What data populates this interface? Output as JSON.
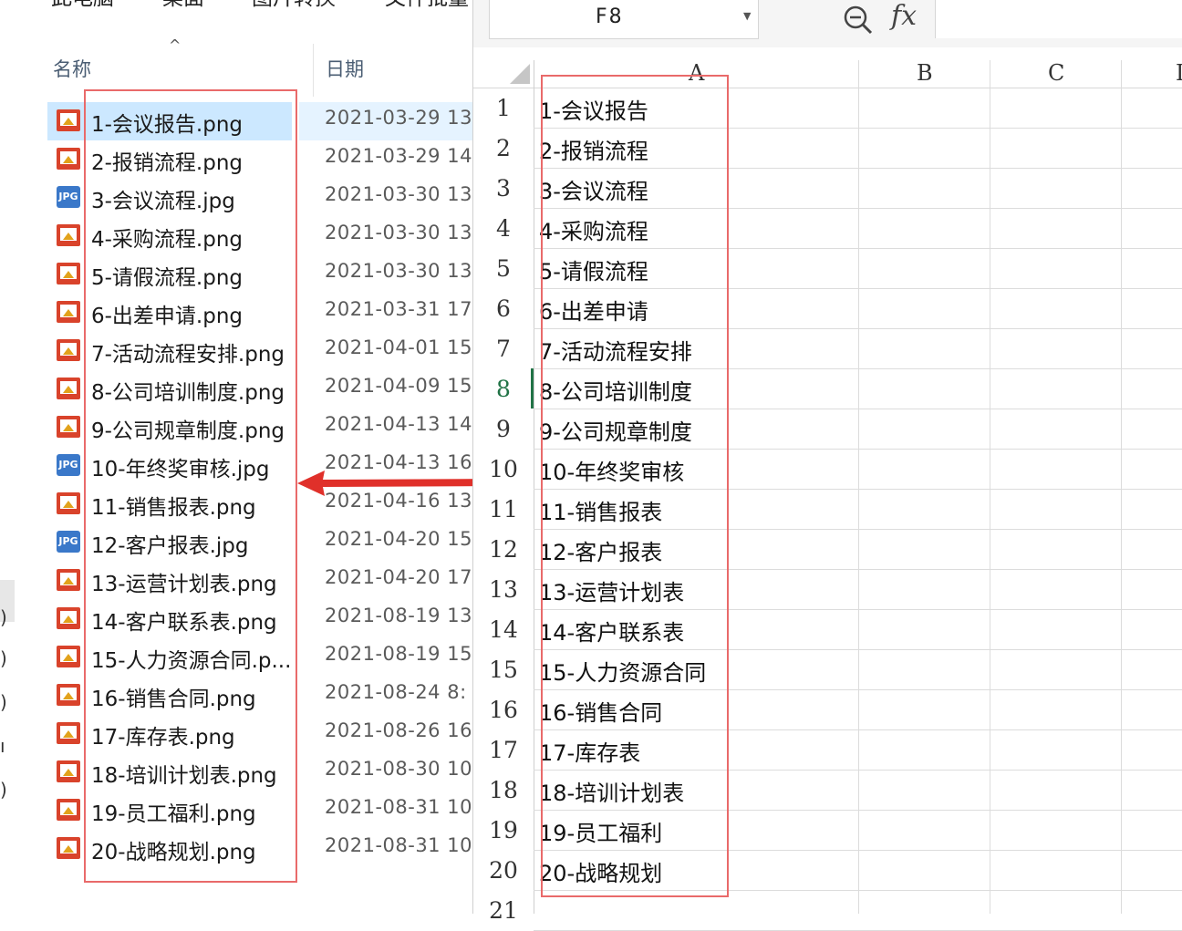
{
  "explorer": {
    "breadcrumb": [
      "此电脑",
      "桌面",
      "图片转换",
      "文件批量"
    ],
    "columns": {
      "name": "名称",
      "date": "日期"
    },
    "nav_fragments": [
      ")",
      ")",
      ")",
      "ı",
      ")"
    ],
    "files": [
      {
        "name": "1-会议报告.png",
        "date": "2021-03-29 13",
        "type": "png"
      },
      {
        "name": "2-报销流程.png",
        "date": "2021-03-29 14",
        "type": "png"
      },
      {
        "name": "3-会议流程.jpg",
        "date": "2021-03-30 13",
        "type": "jpg"
      },
      {
        "name": "4-采购流程.png",
        "date": "2021-03-30 13",
        "type": "png"
      },
      {
        "name": "5-请假流程.png",
        "date": "2021-03-30 13",
        "type": "png"
      },
      {
        "name": "6-出差申请.png",
        "date": "2021-03-31 17",
        "type": "png"
      },
      {
        "name": "7-活动流程安排.png",
        "date": "2021-04-01 15",
        "type": "png"
      },
      {
        "name": "8-公司培训制度.png",
        "date": "2021-04-09 15",
        "type": "png"
      },
      {
        "name": "9-公司规章制度.png",
        "date": "2021-04-13 14",
        "type": "png"
      },
      {
        "name": "10-年终奖审核.jpg",
        "date": "2021-04-13 16",
        "type": "jpg"
      },
      {
        "name": "11-销售报表.png",
        "date": "2021-04-16 13",
        "type": "png"
      },
      {
        "name": "12-客户报表.jpg",
        "date": "2021-04-20 15",
        "type": "jpg"
      },
      {
        "name": "13-运营计划表.png",
        "date": "2021-04-20 17",
        "type": "png"
      },
      {
        "name": "14-客户联系表.png",
        "date": "2021-08-19 13",
        "type": "png"
      },
      {
        "name": "15-人力资源合同.p...",
        "date": "2021-08-19 15",
        "type": "png"
      },
      {
        "name": "16-销售合同.png",
        "date": "2021-08-24 8:",
        "type": "png"
      },
      {
        "name": "17-库存表.png",
        "date": "2021-08-26 16",
        "type": "png"
      },
      {
        "name": "18-培训计划表.png",
        "date": "2021-08-30 10",
        "type": "png"
      },
      {
        "name": "19-员工福利.png",
        "date": "2021-08-31 10",
        "type": "png"
      },
      {
        "name": "20-战略规划.png",
        "date": "2021-08-31 10",
        "type": "png"
      }
    ],
    "jpg_icon_label": "JPG"
  },
  "spreadsheet": {
    "name_box": "F8",
    "fx_label": "fx",
    "columns": [
      "A",
      "B",
      "C",
      "D"
    ],
    "active_row": 8,
    "rows": [
      {
        "num": "1",
        "a": "1-会议报告"
      },
      {
        "num": "2",
        "a": "2-报销流程"
      },
      {
        "num": "3",
        "a": "3-会议流程"
      },
      {
        "num": "4",
        "a": "4-采购流程"
      },
      {
        "num": "5",
        "a": "5-请假流程"
      },
      {
        "num": "6",
        "a": "6-出差申请"
      },
      {
        "num": "7",
        "a": "7-活动流程安排"
      },
      {
        "num": "8",
        "a": "8-公司培训制度"
      },
      {
        "num": "9",
        "a": "9-公司规章制度"
      },
      {
        "num": "10",
        "a": "10-年终奖审核"
      },
      {
        "num": "11",
        "a": "11-销售报表"
      },
      {
        "num": "12",
        "a": "12-客户报表"
      },
      {
        "num": "13",
        "a": "13-运营计划表"
      },
      {
        "num": "14",
        "a": "14-客户联系表"
      },
      {
        "num": "15",
        "a": "15-人力资源合同"
      },
      {
        "num": "16",
        "a": "16-销售合同"
      },
      {
        "num": "17",
        "a": "17-库存表"
      },
      {
        "num": "18",
        "a": "18-培训计划表"
      },
      {
        "num": "19",
        "a": "19-员工福利"
      },
      {
        "num": "20",
        "a": "20-战略规划"
      },
      {
        "num": "21",
        "a": ""
      }
    ]
  },
  "colors": {
    "highlight_box": "#e96a6a",
    "arrow": "#e0302a",
    "selection": "#cce8ff",
    "active_row": "#217346"
  }
}
